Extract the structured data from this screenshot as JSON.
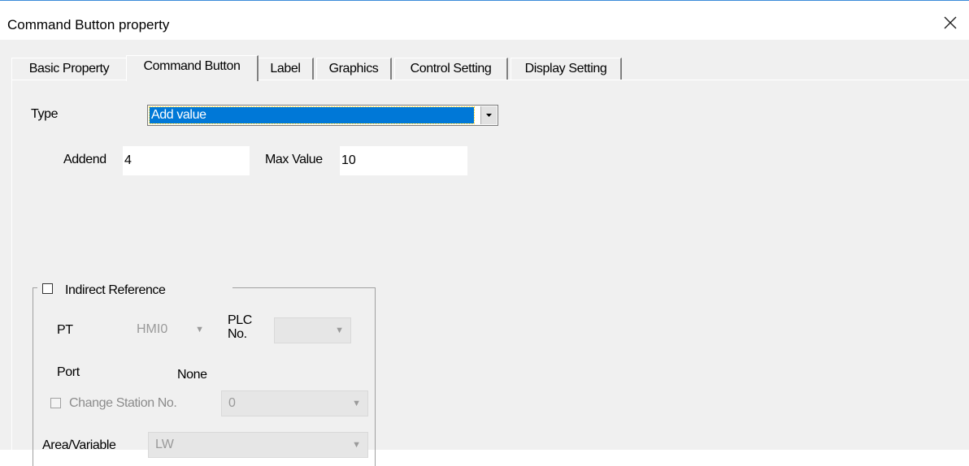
{
  "window": {
    "title": "Command Button property"
  },
  "tabs": [
    {
      "label": "Basic Property",
      "active": false
    },
    {
      "label": "Command Button",
      "active": true
    },
    {
      "label": "Label",
      "active": false
    },
    {
      "label": "Graphics",
      "active": false
    },
    {
      "label": "Control Setting",
      "active": false
    },
    {
      "label": "Display Setting",
      "active": false
    }
  ],
  "form": {
    "type_label": "Type",
    "type_value": "Add value",
    "addend_label": "Addend",
    "addend_value": "4",
    "max_value_label": "Max Value",
    "max_value_value": "10"
  },
  "indirect": {
    "checkbox_label": "Indirect Reference",
    "checked": false,
    "pt_label": "PT",
    "pt_value": "HMI0",
    "plc_label_line1": "PLC",
    "plc_label_line2": "No.",
    "plc_value": "",
    "port_label": "Port",
    "port_value": "None",
    "change_station_label": "Change Station No.",
    "change_station_value": "0",
    "area_label": "Area/Variable",
    "area_value": "LW"
  },
  "colors": {
    "selection": "#0078d7",
    "dialog_bg": "#f0f0f0",
    "title_accent": "#3b8bd9"
  }
}
